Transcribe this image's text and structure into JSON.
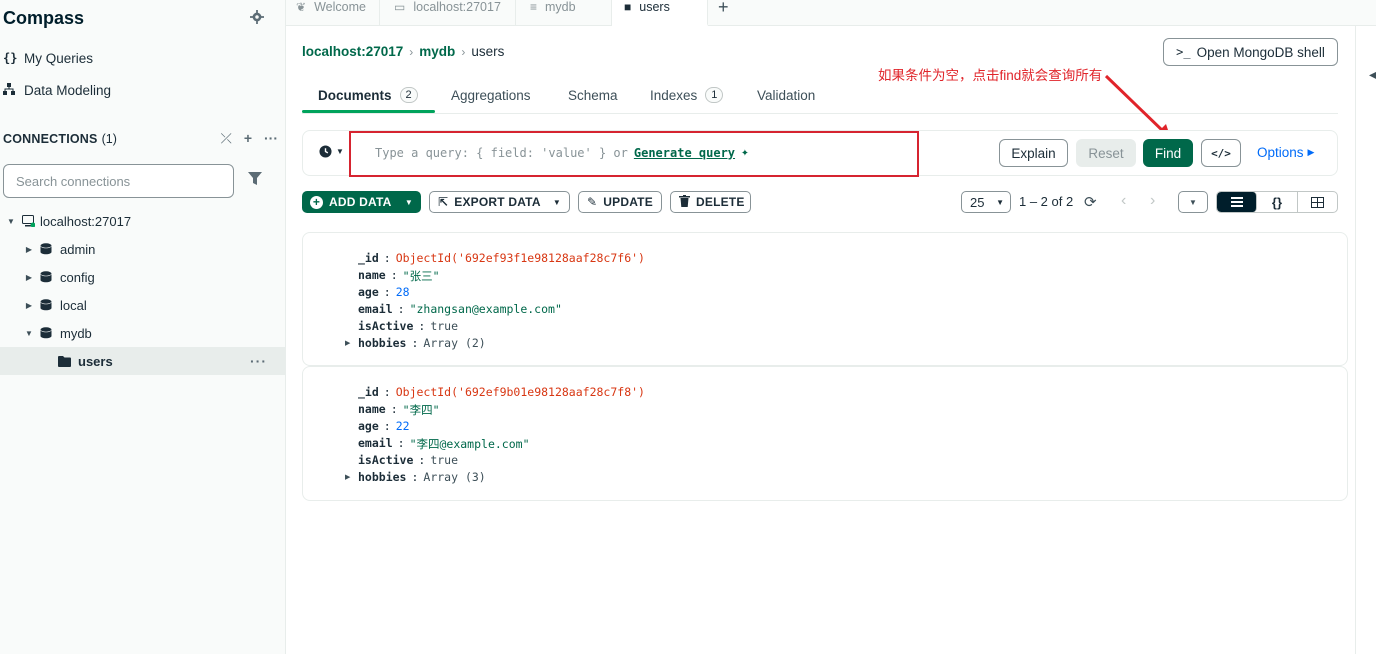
{
  "sidebar": {
    "app_title": "Compass",
    "nav": [
      {
        "icon": "{}",
        "label": "My Queries"
      },
      {
        "icon": "⁂",
        "label": "Data Modeling"
      }
    ],
    "connections_label": "CONNECTIONS",
    "connections_count": "(1)",
    "search_placeholder": "Search connections",
    "tree": {
      "host": "localhost:27017",
      "databases": [
        "admin",
        "config",
        "local",
        "mydb"
      ],
      "collection": "users"
    }
  },
  "tabs": [
    {
      "label": "Welcome"
    },
    {
      "label": "localhost:27017"
    },
    {
      "label": "mydb"
    },
    {
      "label": "users"
    }
  ],
  "breadcrumb": {
    "host": "localhost:27017",
    "db": "mydb",
    "collection": "users"
  },
  "shell_button": {
    "prompt": ">_",
    "label": "Open MongoDB shell"
  },
  "subtabs": {
    "documents": "Documents",
    "documents_count": "2",
    "aggregations": "Aggregations",
    "schema": "Schema",
    "indexes": "Indexes",
    "indexes_count": "1",
    "validation": "Validation"
  },
  "annotation": "如果条件为空，点击find就会查询所有",
  "query": {
    "placeholder": "Type a query: { field: 'value' } or",
    "generate": "Generate query",
    "explain": "Explain",
    "reset": "Reset",
    "find": "Find",
    "options": "Options"
  },
  "toolbar": {
    "add_data": "ADD DATA",
    "export_data": "EXPORT DATA",
    "update": "UPDATE",
    "delete": "DELETE",
    "page_size": "25",
    "page_info": "1 – 2 of 2"
  },
  "documents": [
    {
      "id": "ObjectId('692ef93f1e98128aaf28c7f6')",
      "name": "\"张三\"",
      "age": "28",
      "email": "\"zhangsan@example.com\"",
      "isActive": "true",
      "hobbies": "Array (2)"
    },
    {
      "id": "ObjectId('692ef9b01e98128aaf28c7f8')",
      "name": "\"李四\"",
      "age": "22",
      "email": "\"李四@example.com\"",
      "isActive": "true",
      "hobbies": "Array (3)"
    }
  ],
  "colors": {
    "brand_green": "#00684a",
    "annotation_red": "#e0242a",
    "link_blue": "#016bf8"
  }
}
